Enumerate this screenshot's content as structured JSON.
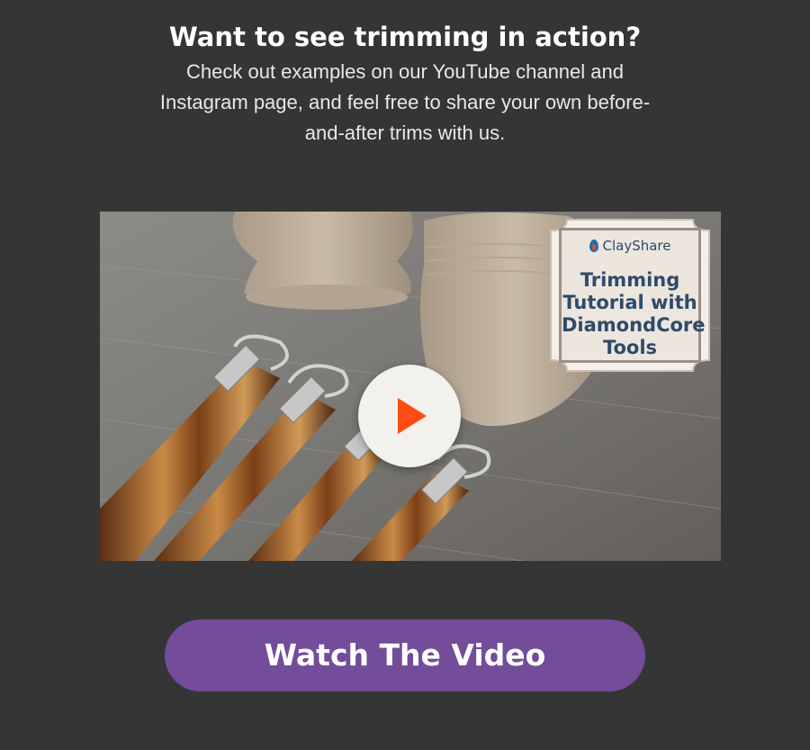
{
  "header": {
    "title": "Want to see trimming in action?",
    "subtext_lines": [
      "Check out examples on our YouTube channel and",
      "Instagram page, and feel free to share your own before-",
      "and-after trims with us."
    ]
  },
  "video": {
    "thumbnail_icon": "play-icon",
    "badge": {
      "logo_text": "ClayShare",
      "title_lines": [
        "Trimming",
        "Tutorial with",
        "DiamondCore",
        "Tools"
      ]
    }
  },
  "cta": {
    "label": "Watch The Video"
  },
  "colors": {
    "background": "#353535",
    "button": "#734c9a",
    "play_triangle": "#ff4d15",
    "badge_text": "#2f4a6a"
  }
}
